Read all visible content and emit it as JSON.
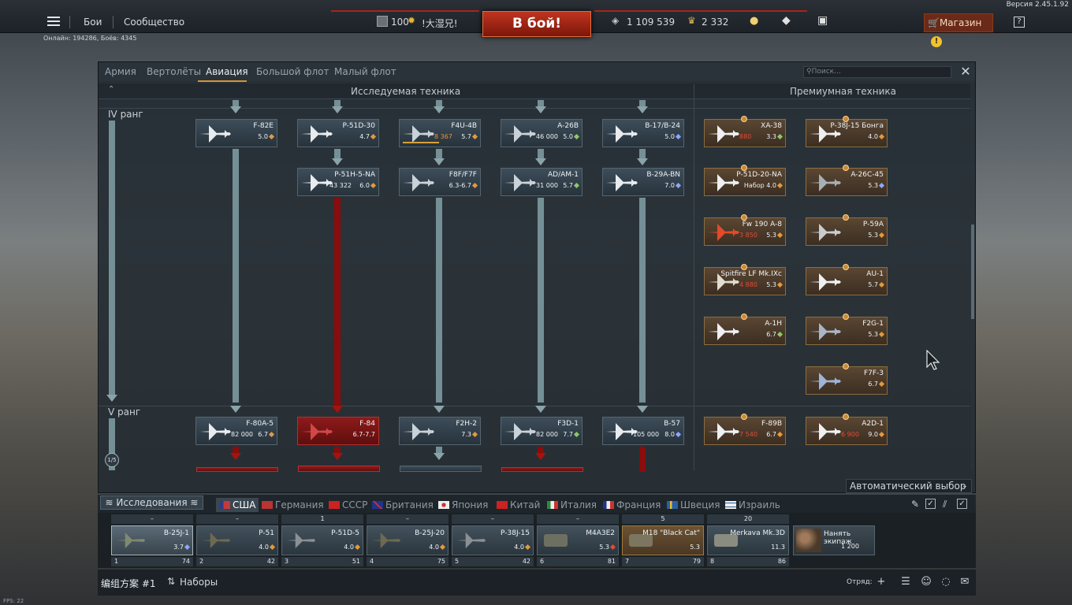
{
  "version": "Версия 2.45.1.92",
  "topbar": {
    "battles": "Бои",
    "community": "Сообщество",
    "level": "100",
    "nickname": "!大湿兄!",
    "to_battle": "В бой!",
    "silver": "1 109 539",
    "gold": "2 332",
    "shop": "Магазин",
    "shop_alert": "!",
    "help": "?"
  },
  "online": "Онлайн: 194286, Боёв: 4345",
  "tabs": [
    "Армия",
    "Вертолёты",
    "Авиация",
    "Большой флот",
    "Малый флот"
  ],
  "active_tab": "Авиация",
  "search_placeholder": "Поиск...",
  "headers": {
    "researched": "Исследуемая техника",
    "premium": "Премиумная техника"
  },
  "ranks": {
    "iv": "IV ранг",
    "v": "V ранг"
  },
  "rank_progress": "1/5",
  "tree": [
    {
      "name": "F-82E",
      "br": "5.0",
      "rp": ""
    },
    {
      "name": "P-51D-30",
      "br": "4.7",
      "rp": ""
    },
    {
      "name": "F4U-4B",
      "br": "5.7",
      "rp": "8 367"
    },
    {
      "name": "A-26B",
      "br": "5.0",
      "rp": "46 000"
    },
    {
      "name": "B-17/B-24",
      "br": "5.0",
      "rp": ""
    },
    {
      "name": "P-51H-5-NA",
      "br": "6.0",
      "rp": "43 322"
    },
    {
      "name": "F8F/F7F",
      "br": "6.3-6.7",
      "rp": ""
    },
    {
      "name": "AD/AM-1",
      "br": "5.7",
      "rp": "31 000"
    },
    {
      "name": "B-29A-BN",
      "br": "7.0",
      "rp": ""
    },
    {
      "name": "F-80A-5",
      "br": "6.7",
      "rp": "82 000"
    },
    {
      "name": "F-84",
      "br": "6.7-7.7",
      "rp": ""
    },
    {
      "name": "F2H-2",
      "br": "7.3",
      "rp": ""
    },
    {
      "name": "F3D-1",
      "br": "7.7",
      "rp": "82 000"
    },
    {
      "name": "B-57",
      "br": "8.0",
      "rp": "105 000"
    }
  ],
  "premium": [
    {
      "name": "XA-38",
      "br": "3.3",
      "rp": "880"
    },
    {
      "name": "P-38J-15 Бонга",
      "br": "4.0",
      "rp": ""
    },
    {
      "name": "P-51D-20-NA",
      "br": "Набор 4.0",
      "rp": ""
    },
    {
      "name": "A-26C-45",
      "br": "5.3",
      "rp": ""
    },
    {
      "name": "Fw 190 A-8",
      "br": "5.3",
      "rp": "3 850"
    },
    {
      "name": "P-59A",
      "br": "5.3",
      "rp": ""
    },
    {
      "name": "Spitfire LF Mk.IXc",
      "br": "5.3",
      "rp": "4 880"
    },
    {
      "name": "AU-1",
      "br": "5.7",
      "rp": ""
    },
    {
      "name": "A-1H",
      "br": "6.7",
      "rp": ""
    },
    {
      "name": "F2G-1",
      "br": "5.3",
      "rp": ""
    },
    {
      "name": "F7F-3",
      "br": "6.7",
      "rp": ""
    },
    {
      "name": "F-89B",
      "br": "6.7",
      "rp": "7 540"
    },
    {
      "name": "A2D-1",
      "br": "9.0",
      "rp": "6 900"
    }
  ],
  "auto_select": "Автоматический выбор",
  "research_btn": "Исследования",
  "nations": [
    "США",
    "Германия",
    "СССР",
    "Британия",
    "Япония",
    "Китай",
    "Италия",
    "Франция",
    "Швеция",
    "Израиль"
  ],
  "slots": [
    {
      "head": "–",
      "name": "B-25J-1",
      "br": "3.7",
      "num": "1",
      "rp": "74"
    },
    {
      "head": "–",
      "name": "P-51",
      "br": "4.0",
      "num": "2",
      "rp": "42"
    },
    {
      "head": "1",
      "name": "P-51D-5",
      "br": "4.0",
      "num": "3",
      "rp": "51"
    },
    {
      "head": "–",
      "name": "B-25J-20",
      "br": "4.0",
      "num": "4",
      "rp": "75"
    },
    {
      "head": "–",
      "name": "P-38J-15",
      "br": "4.0",
      "num": "5",
      "rp": "42"
    },
    {
      "head": "–",
      "name": "M4A3E2",
      "br": "5.3",
      "num": "6",
      "rp": "81"
    },
    {
      "head": "5",
      "name": "M18 \"Black Cat\"",
      "br": "5.3",
      "num": "7",
      "rp": "79"
    },
    {
      "head": "20",
      "name": "Merkava Mk.3D",
      "br": "11.3",
      "num": "8",
      "rp": "86"
    }
  ],
  "hire": {
    "label": "Нанять экипаж",
    "cost": "1 200"
  },
  "bottom": {
    "preset": "编组方案 #1",
    "sets": "Наборы",
    "squad": "Отряд:"
  },
  "fps": "FPS: 22"
}
